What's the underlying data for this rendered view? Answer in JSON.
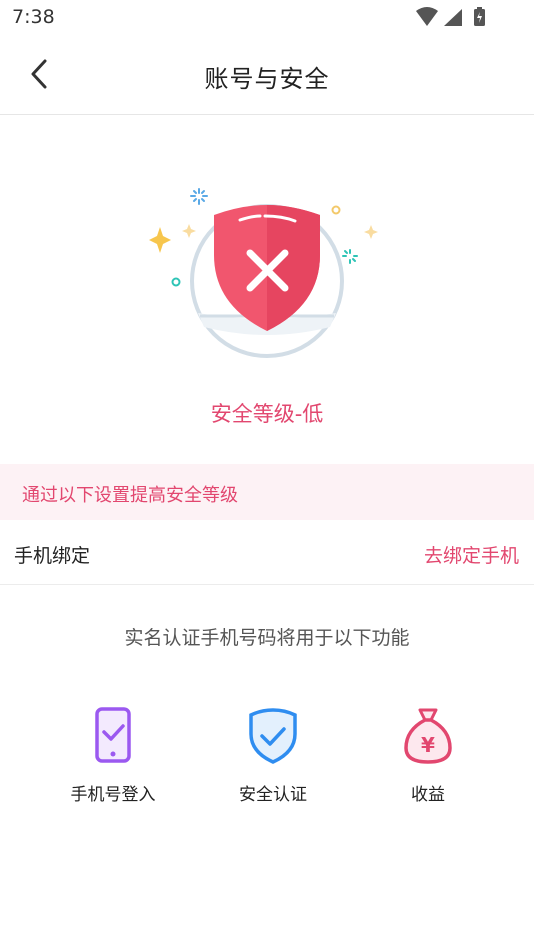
{
  "status_bar": {
    "time": "7:38"
  },
  "header": {
    "title": "账号与安全"
  },
  "security": {
    "level_text": "安全等级-低"
  },
  "tip": {
    "text": "通过以下设置提高安全等级"
  },
  "bind_phone": {
    "label": "手机绑定",
    "action": "去绑定手机"
  },
  "features": {
    "caption": "实名认证手机号码将用于以下功能",
    "items": [
      {
        "label": "手机号登入",
        "icon": "phone-check-icon",
        "color": "#9b59f0"
      },
      {
        "label": "安全认证",
        "icon": "shield-check-icon",
        "color": "#2f8df0"
      },
      {
        "label": "收益",
        "icon": "money-bag-icon",
        "color": "#e2476f"
      }
    ]
  },
  "colors": {
    "accent": "#e2476f",
    "tip_bg": "#fdf2f5"
  }
}
